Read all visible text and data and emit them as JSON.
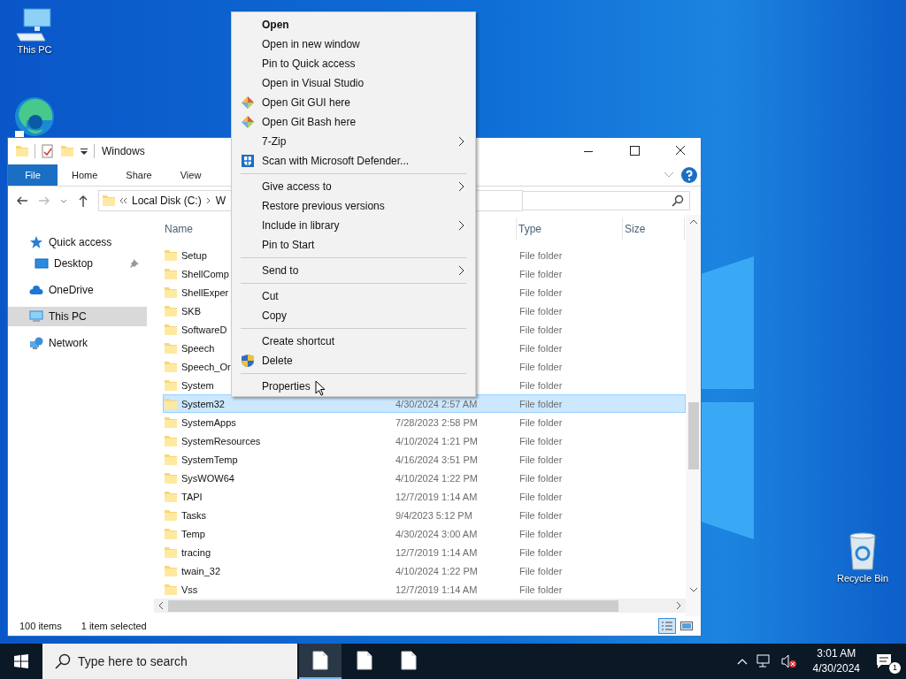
{
  "desktop_icons": [
    {
      "kind": "pc",
      "label": "This PC"
    },
    {
      "kind": "edge"
    },
    {
      "kind": "recycle",
      "label": "Recycle Bin"
    }
  ],
  "explorer": {
    "title": "Windows",
    "ribbon_tabs": [
      {
        "label": "File",
        "selected": true
      },
      {
        "label": "Home",
        "selected": false
      },
      {
        "label": "Share",
        "selected": false
      },
      {
        "label": "View",
        "selected": false
      }
    ],
    "breadcrumb": [
      "Local Disk (C:)",
      "W"
    ],
    "nav_items": [
      {
        "label": "Quick access",
        "kind": "star",
        "selected": false,
        "children": [
          {
            "label": "Desktop",
            "kind": "desktop",
            "selected": false,
            "pinned": true
          }
        ]
      },
      {
        "label": "OneDrive",
        "kind": "cloud",
        "selected": false
      },
      {
        "label": "This PC",
        "kind": "pc",
        "selected": true
      },
      {
        "label": "Network",
        "kind": "network",
        "selected": false
      }
    ],
    "columns": [
      {
        "kind": "name",
        "label": "Name"
      },
      {
        "kind": "date"
      },
      {
        "kind": "type",
        "label": "Type"
      },
      {
        "kind": "size",
        "label": "Size"
      }
    ],
    "rows": [
      {
        "name": "Setup",
        "type": "File folder",
        "selected": false
      },
      {
        "name": "ShellComp",
        "type": "File folder",
        "selected": false
      },
      {
        "name": "ShellExper",
        "type": "File folder",
        "selected": false
      },
      {
        "name": "SKB",
        "type": "File folder",
        "selected": false
      },
      {
        "name": "SoftwareD",
        "type": "File folder",
        "selected": false
      },
      {
        "name": "Speech",
        "type": "File folder",
        "selected": false
      },
      {
        "name": "Speech_Or",
        "type": "File folder",
        "selected": false
      },
      {
        "name": "System",
        "type": "File folder",
        "selected": false
      },
      {
        "name": "System32",
        "date": "4/30/2024 2:57 AM",
        "type": "File folder",
        "selected": true
      },
      {
        "name": "SystemApps",
        "date": "7/28/2023 2:58 PM",
        "type": "File folder",
        "selected": false
      },
      {
        "name": "SystemResources",
        "date": "4/10/2024 1:21 PM",
        "type": "File folder",
        "selected": false
      },
      {
        "name": "SystemTemp",
        "date": "4/16/2024 3:51 PM",
        "type": "File folder",
        "selected": false
      },
      {
        "name": "SysWOW64",
        "date": "4/10/2024 1:22 PM",
        "type": "File folder",
        "selected": false
      },
      {
        "name": "TAPI",
        "date": "12/7/2019 1:14 AM",
        "type": "File folder",
        "selected": false
      },
      {
        "name": "Tasks",
        "date": "9/4/2023 5:12 PM",
        "type": "File folder",
        "selected": false
      },
      {
        "name": "Temp",
        "date": "4/30/2024 3:00 AM",
        "type": "File folder",
        "selected": false
      },
      {
        "name": "tracing",
        "date": "12/7/2019 1:14 AM",
        "type": "File folder",
        "selected": false
      },
      {
        "name": "twain_32",
        "date": "4/10/2024 1:22 PM",
        "type": "File folder",
        "selected": false
      },
      {
        "name": "Vss",
        "date": "12/7/2019 1:14 AM",
        "type": "File folder",
        "selected": false
      }
    ],
    "status": {
      "item_count": "100 items",
      "selection": "1 item selected"
    }
  },
  "context_menu": [
    {
      "kind": "item",
      "label": "Open",
      "default": true,
      "submenu": false
    },
    {
      "kind": "item",
      "label": "Open in new window",
      "default": false,
      "submenu": false
    },
    {
      "kind": "item",
      "label": "Pin to Quick access",
      "default": false,
      "submenu": false
    },
    {
      "kind": "item",
      "label": "Open in Visual Studio",
      "default": false,
      "submenu": false
    },
    {
      "kind": "git_item",
      "label": "Open Git GUI here",
      "default": false,
      "submenu": false
    },
    {
      "kind": "git_item",
      "label": "Open Git Bash here",
      "default": false,
      "submenu": false
    },
    {
      "kind": "item",
      "label": "7-Zip",
      "default": false,
      "submenu": true
    },
    {
      "kind": "defender_item",
      "label": "Scan with Microsoft Defender...",
      "default": false,
      "submenu": false
    },
    {
      "kind": "separator"
    },
    {
      "kind": "item",
      "label": "Give access to",
      "default": false,
      "submenu": true
    },
    {
      "kind": "item",
      "label": "Restore previous versions",
      "default": false,
      "submenu": false
    },
    {
      "kind": "item",
      "label": "Include in library",
      "default": false,
      "submenu": true
    },
    {
      "kind": "item",
      "label": "Pin to Start",
      "default": false,
      "submenu": false
    },
    {
      "kind": "separator"
    },
    {
      "kind": "item",
      "label": "Send to",
      "default": false,
      "submenu": true
    },
    {
      "kind": "separator"
    },
    {
      "kind": "item",
      "label": "Cut",
      "default": false,
      "submenu": false
    },
    {
      "kind": "item",
      "label": "Copy",
      "default": false,
      "submenu": false
    },
    {
      "kind": "separator"
    },
    {
      "kind": "item",
      "label": "Create shortcut",
      "default": false,
      "submenu": false
    },
    {
      "kind": "shield_item",
      "label": "Delete",
      "default": false,
      "submenu": false
    },
    {
      "kind": "separator"
    },
    {
      "kind": "item",
      "label": "Properties",
      "default": false,
      "submenu": false
    }
  ],
  "taskbar": {
    "search": {
      "placeholder": "Type here to search"
    },
    "apps": [
      {
        "kind": "document",
        "selected": true
      },
      {
        "kind": "document",
        "selected": false
      },
      {
        "kind": "document",
        "selected": false
      }
    ],
    "volume_muted": true,
    "time": "3:01 AM",
    "date": "4/30/2024",
    "notification_count": "1"
  }
}
